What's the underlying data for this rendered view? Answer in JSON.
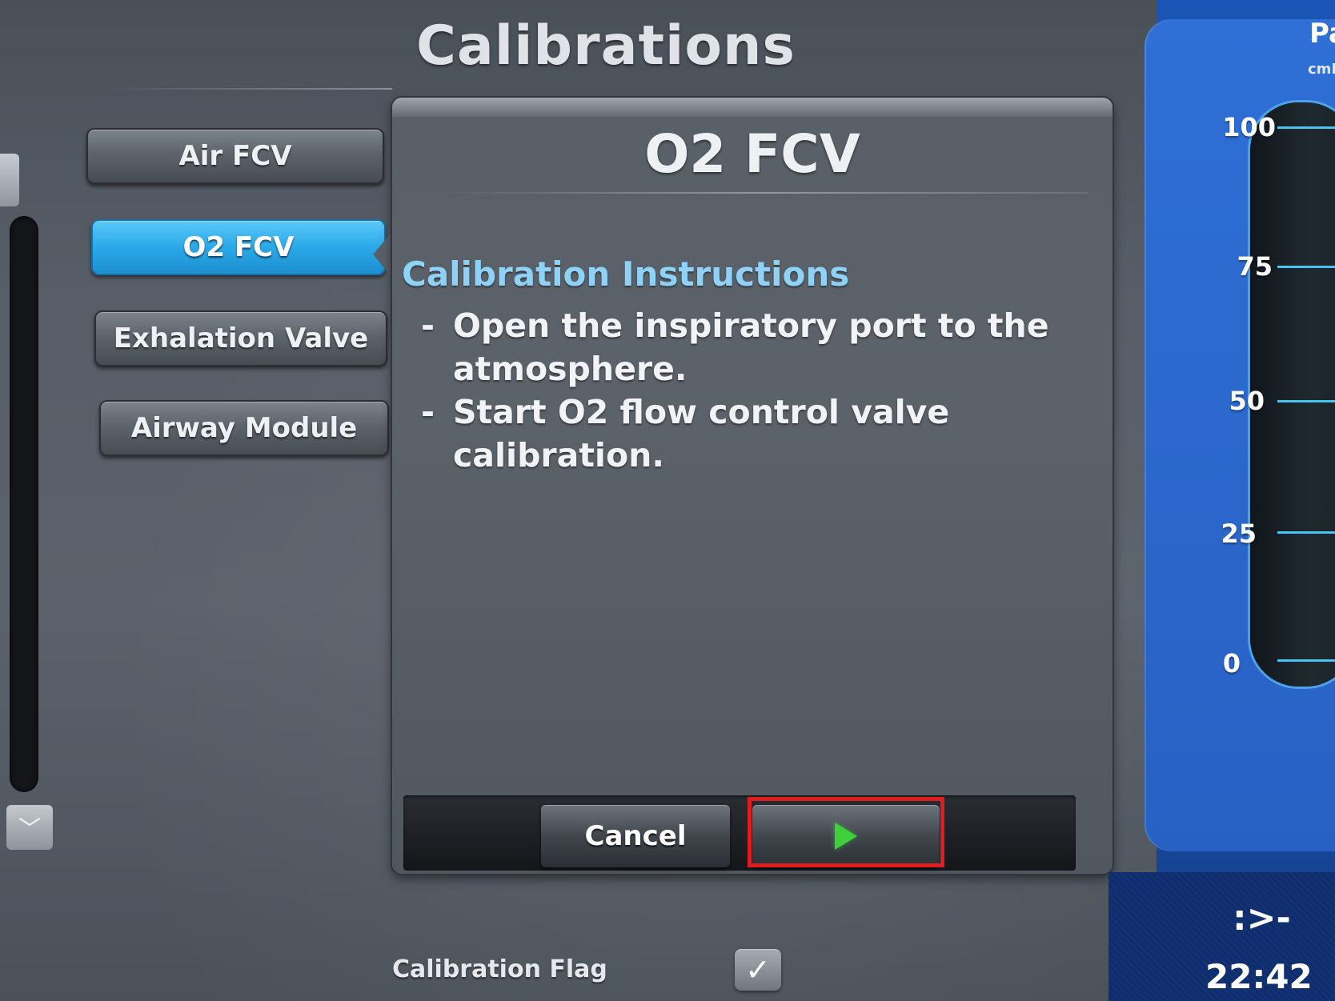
{
  "dialog": {
    "title": "Calibrations"
  },
  "menu": {
    "items": [
      {
        "label": "Air FCV",
        "active": false
      },
      {
        "label": "O2 FCV",
        "active": true
      },
      {
        "label": "Exhalation Valve",
        "active": false
      },
      {
        "label": "Airway Module",
        "active": false
      }
    ]
  },
  "panel": {
    "title": "O2 FCV",
    "instructions_heading": "Calibration Instructions",
    "instructions": [
      {
        "dash": "-",
        "text": "Open the inspiratory port to the atmosphere."
      },
      {
        "dash": "-",
        "text": "Start O2 flow control valve calibration."
      }
    ]
  },
  "actions": {
    "cancel_label": "Cancel",
    "start_icon": "play-icon",
    "highlight_color": "#e01d1f",
    "start_icon_color": "#3fcf3a"
  },
  "calibration_flag": {
    "label": "Calibration Flag",
    "checked": true,
    "check_glyph": "✓"
  },
  "gauge": {
    "title": "Pa",
    "unit": "cmH",
    "ticks": [
      "100",
      "75",
      "50",
      "25",
      "0"
    ]
  },
  "status": {
    "breath_icon": ":>-",
    "time": "22:42"
  },
  "colors": {
    "active_tab": "#2aa9e8",
    "heading_blue": "#8ed3f7",
    "gauge_blue": "#2861c4"
  }
}
